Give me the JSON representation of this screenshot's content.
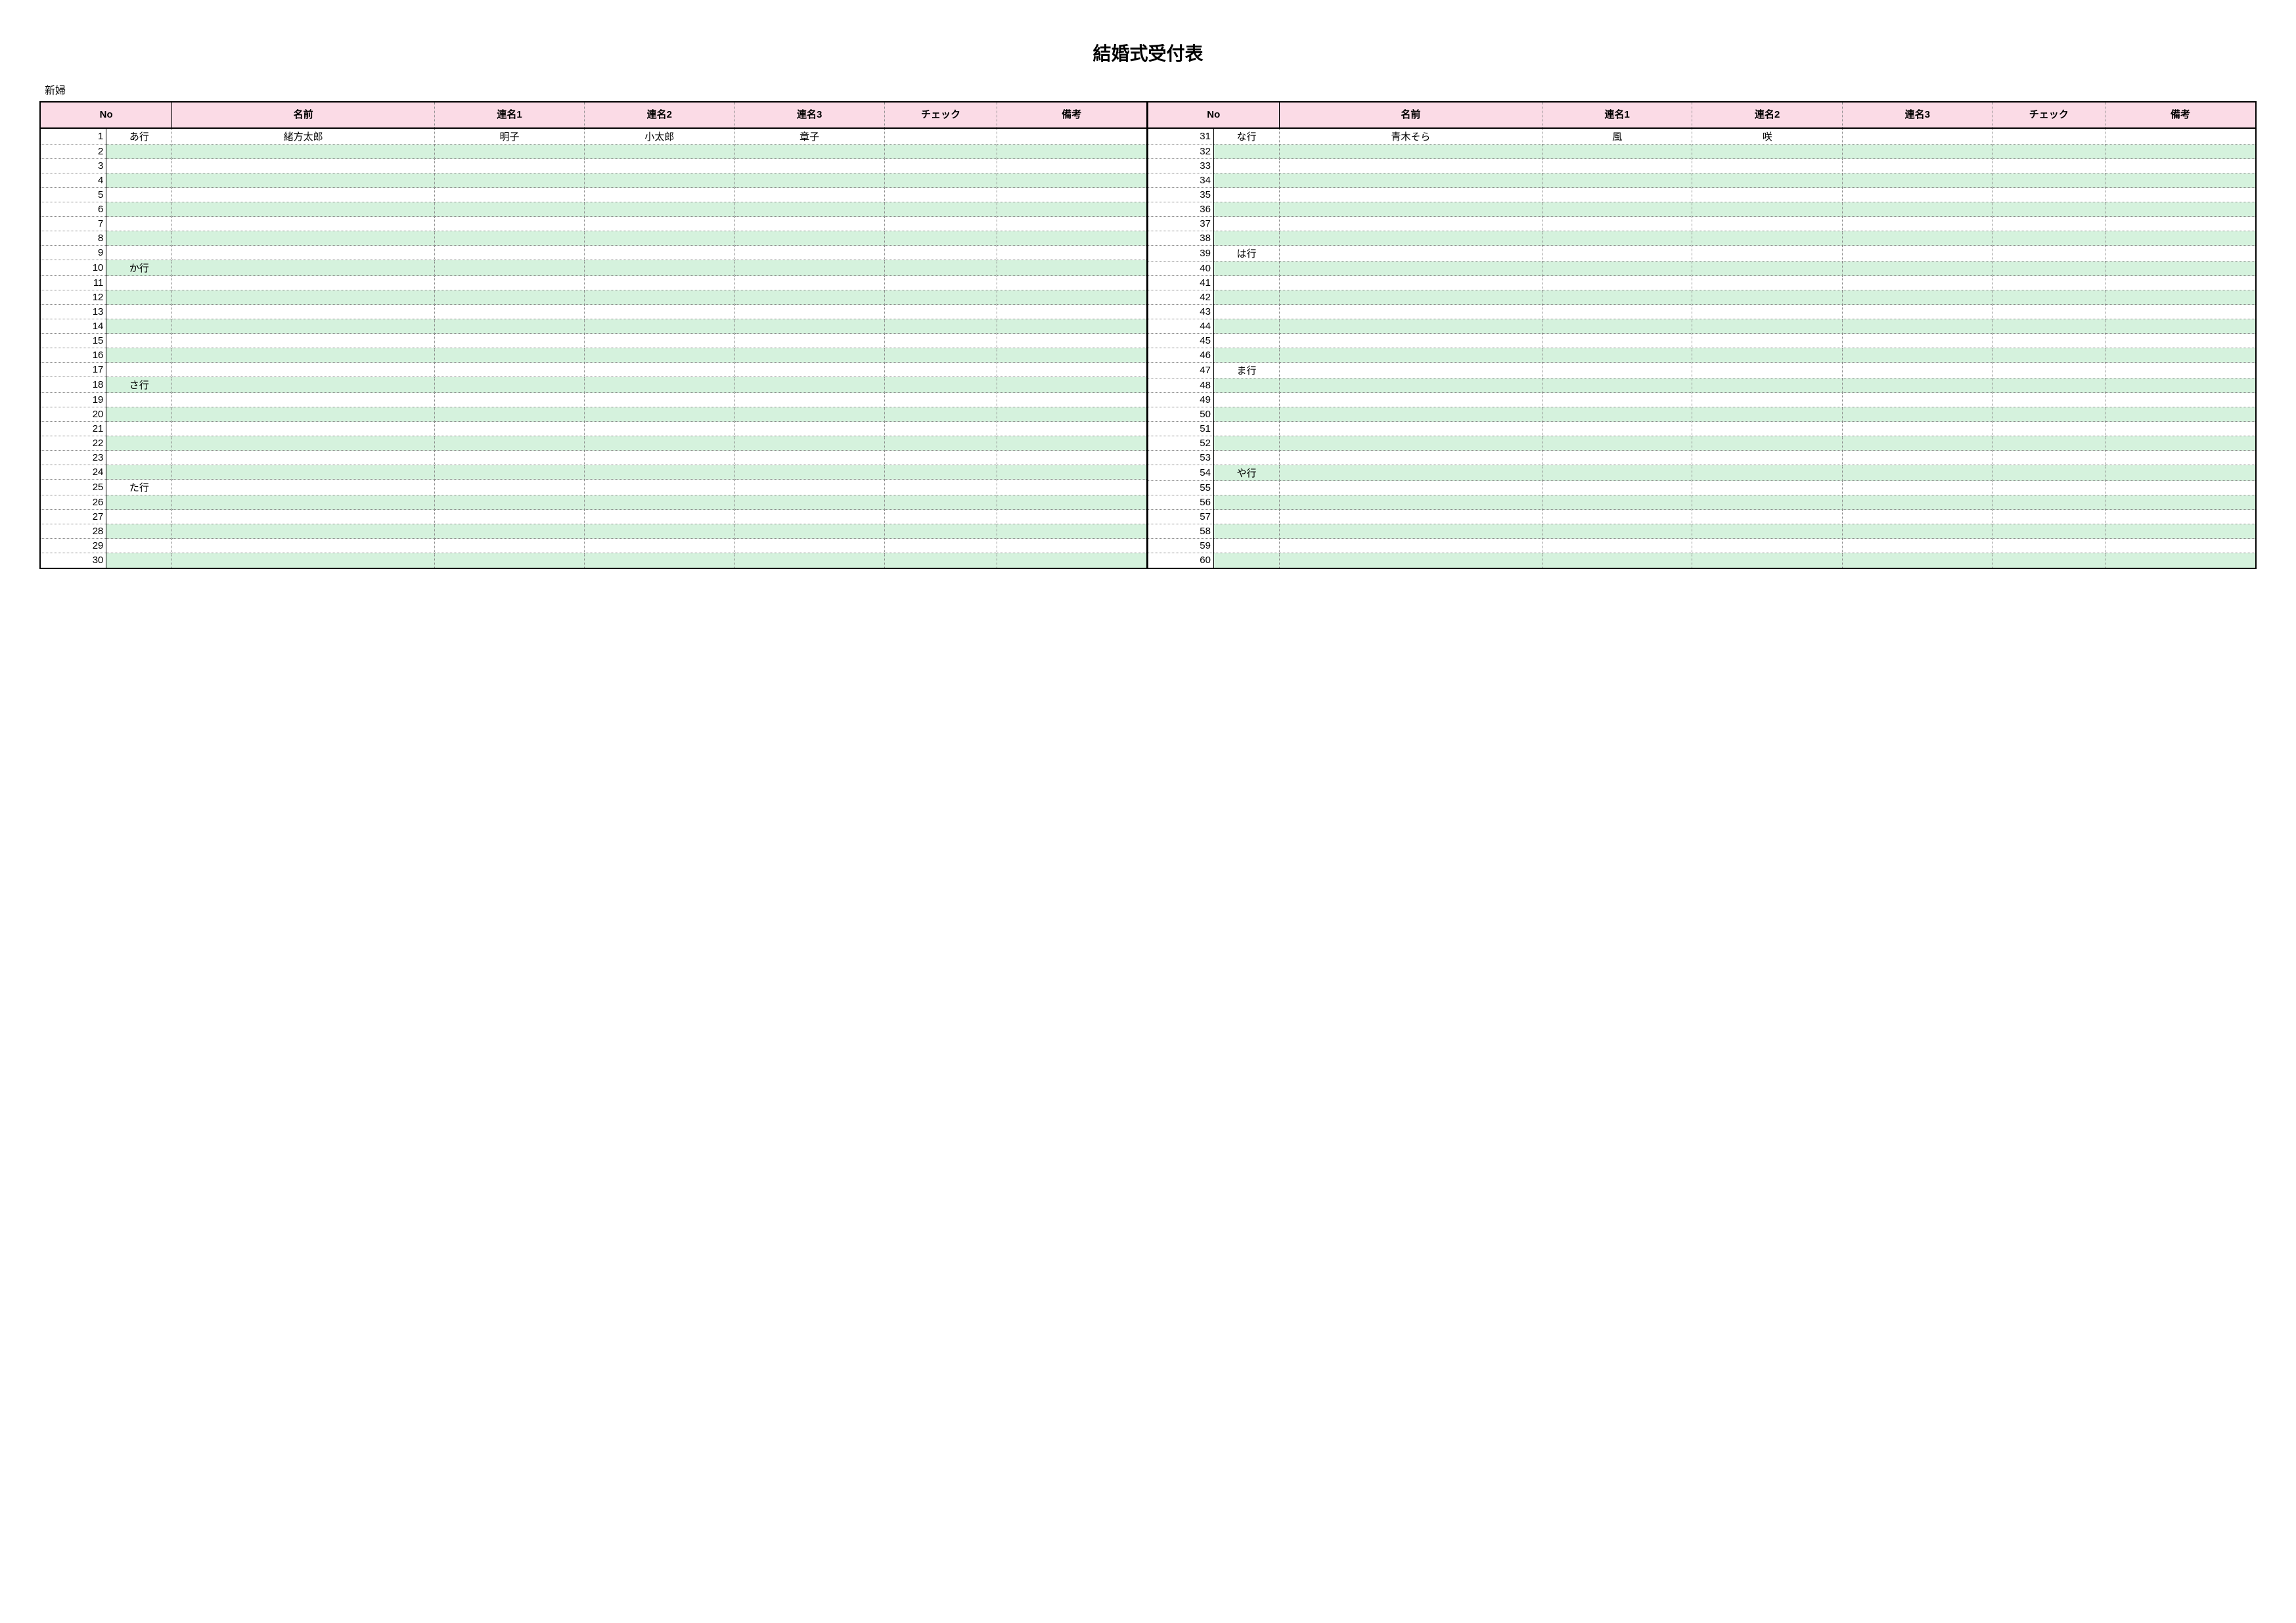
{
  "title": "結婚式受付表",
  "subtitle": "新婦",
  "headers": [
    "No",
    "名前",
    "連名1",
    "連名2",
    "連名3",
    "チェック",
    "備考"
  ],
  "colors": {
    "header_bg": "#fbdbe6",
    "row_even": "#d5f2dd"
  },
  "left": {
    "start": 1,
    "end": 30,
    "groups": {
      "1": "あ行",
      "10": "か行",
      "18": "さ行",
      "25": "た行"
    },
    "rows": {
      "1": {
        "name": "緒方太郎",
        "r1": "明子",
        "r2": "小太郎",
        "r3": "章子"
      }
    }
  },
  "right": {
    "start": 31,
    "end": 60,
    "groups": {
      "31": "な行",
      "39": "は行",
      "47": "ま行",
      "54": "や行"
    },
    "rows": {
      "31": {
        "name": "青木そら",
        "r1": "風",
        "r2": "咲"
      }
    }
  }
}
